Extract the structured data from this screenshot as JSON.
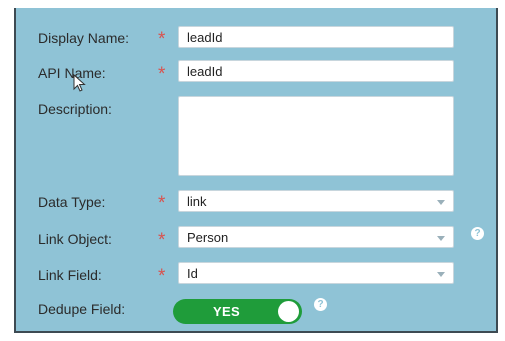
{
  "form": {
    "display_name": {
      "label": "Display Name:",
      "required": "*",
      "value": "leadId"
    },
    "api_name": {
      "label": "API Name:",
      "required": "*",
      "value": "leadId"
    },
    "description": {
      "label": "Description:",
      "value": ""
    },
    "data_type": {
      "label": "Data Type:",
      "required": "*",
      "value": "link"
    },
    "link_object": {
      "label": "Link Object:",
      "required": "*",
      "value": "Person",
      "help": "?"
    },
    "link_field": {
      "label": "Link Field:",
      "required": "*",
      "value": "Id"
    },
    "dedupe_field": {
      "label": "Dedupe Field:",
      "toggle_text": "YES",
      "toggle_on": true,
      "help": "?"
    }
  },
  "colors": {
    "panel_bg": "#8fc3d6",
    "required_star": "#d9534f",
    "toggle_on": "#1f9c3a"
  },
  "icons": [
    "help-icon",
    "chevron-down-icon",
    "mouse-cursor-icon"
  ]
}
